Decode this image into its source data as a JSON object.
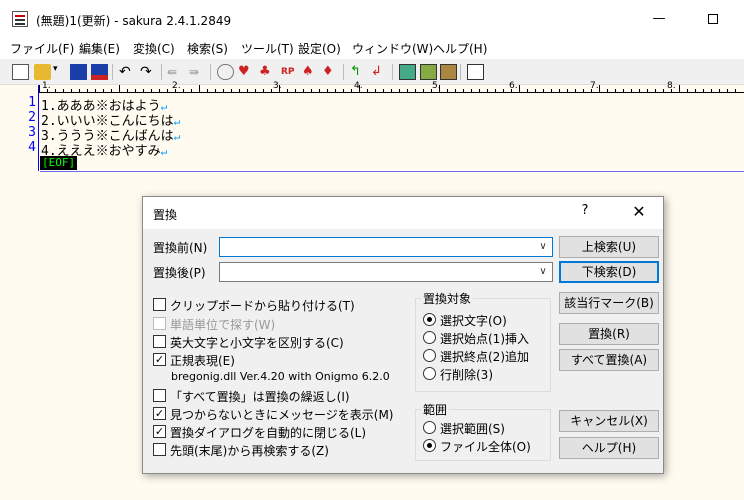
{
  "window": {
    "title": "(無題)1(更新) - sakura 2.4.1.2849",
    "minimize_glyph": "—",
    "maximize_glyph": ""
  },
  "menu": [
    "ファイル(F)",
    "編集(E)",
    "変換(C)",
    "検索(S)",
    "ツール(T)",
    "設定(O)",
    "ウィンドウ(W)",
    "ヘルプ(H)"
  ],
  "ruler": {
    "labels": [
      "1.",
      "2.",
      "3.",
      "4.",
      "5.",
      "6.",
      "7.",
      "8."
    ]
  },
  "editor": {
    "line_numbers": [
      "1",
      "2",
      "3",
      "4"
    ],
    "lines": [
      "1.あああ※おはよう",
      "2.いいい※こんにちは",
      "3.ううう※こんばんは",
      "4.えええ※おやすみ"
    ],
    "newline_mark": "↵",
    "eof": "[EOF]"
  },
  "dialog": {
    "title": "置換",
    "help_glyph": "?",
    "close_glyph": "✕",
    "find_label": "置換前(N)",
    "find_value": "",
    "replace_label": "置換後(P)",
    "replace_value": "",
    "buttons": {
      "search_up": "上検索(U)",
      "search_down": "下検索(D)",
      "mark_lines": "該当行マーク(B)",
      "replace": "置換(R)",
      "replace_all": "すべて置換(A)",
      "cancel": "キャンセル(X)",
      "help": "ヘルプ(H)"
    },
    "options": {
      "paste_clipboard": {
        "label": "クリップボードから貼り付ける(T)",
        "checked": false
      },
      "whole_word": {
        "label": "単語単位で探す(W)",
        "checked": false,
        "disabled": true
      },
      "match_case": {
        "label": "英大文字と小文字を区別する(C)",
        "checked": false
      },
      "regex": {
        "label": "正規表現(E)",
        "checked": true
      },
      "regex_lib": "bregonig.dll Ver.4.20 with Onigmo 6.2.0",
      "repeat_replace_all": {
        "label": "「すべて置換」は置換の繰返し(I)",
        "checked": false
      },
      "show_not_found": {
        "label": "見つからないときにメッセージを表示(M)",
        "checked": true
      },
      "auto_close": {
        "label": "置換ダイアログを自動的に閉じる(L)",
        "checked": true
      },
      "wrap_search": {
        "label": "先頭(末尾)から再検索する(Z)",
        "checked": false
      }
    },
    "target_group": {
      "title": "置換対象",
      "options": [
        "選択文字(O)",
        "選択始点(1)挿入",
        "選択終点(2)追加",
        "行削除(3)"
      ],
      "selected": 0
    },
    "range_group": {
      "title": "範囲",
      "options": [
        "選択範囲(S)",
        "ファイル全体(O)"
      ],
      "selected": 1
    },
    "check_glyph": "✓"
  }
}
